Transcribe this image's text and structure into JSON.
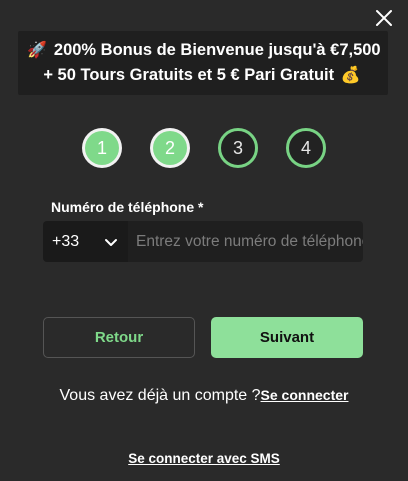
{
  "dialog": {
    "close_icon": "close-icon"
  },
  "banner": {
    "line1_emoji": "🚀",
    "line1_text": "200% Bonus de Bienvenue jusqu'à €7,500",
    "line2_text": "+ 50 Tours Gratuits et 5 € Pari Gratuit",
    "line2_emoji": "💰"
  },
  "steps": [
    {
      "label": "1",
      "state": "done"
    },
    {
      "label": "2",
      "state": "done"
    },
    {
      "label": "3",
      "state": "todo"
    },
    {
      "label": "4",
      "state": "todo"
    }
  ],
  "phone": {
    "label": "Numéro de téléphone *",
    "country_code": "+33",
    "placeholder": "Entrez votre numéro de téléphone",
    "value": ""
  },
  "actions": {
    "back_label": "Retour",
    "next_label": "Suivant"
  },
  "login": {
    "prompt": "Vous avez déjà un compte ?",
    "link_label": "Se connecter",
    "sms_label": "Se connecter avec SMS"
  },
  "colors": {
    "accent": "#8ee09a",
    "background": "#2a2a2a",
    "banner_bg": "#1f1f1f"
  }
}
